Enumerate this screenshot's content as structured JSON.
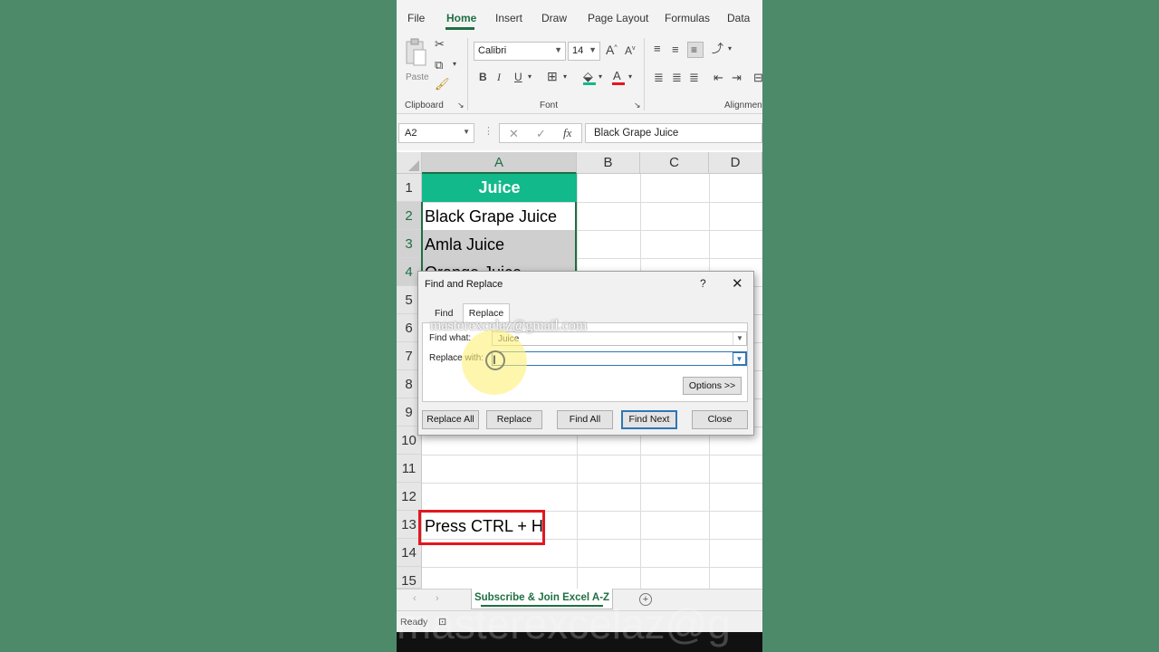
{
  "ribbon": {
    "tabs": [
      "File",
      "Home",
      "Insert",
      "Draw",
      "Page Layout",
      "Formulas",
      "Data"
    ],
    "active_tab": "Home",
    "clipboard": {
      "paste_label": "Paste",
      "group_label": "Clipboard"
    },
    "font": {
      "name": "Calibri",
      "size": "14",
      "group_label": "Font",
      "bold": "B",
      "italic": "I",
      "underline": "U",
      "font_color_glyph": "A",
      "grow_glyph": "A",
      "shrink_glyph": "A"
    },
    "alignment": {
      "group_label": "Alignment"
    }
  },
  "formula_bar": {
    "name_box": "A2",
    "fx_glyph": "fx",
    "value": "Black Grape Juice"
  },
  "grid": {
    "columns": [
      "A",
      "B",
      "C",
      "D"
    ],
    "rows": [
      "1",
      "2",
      "3",
      "4",
      "5",
      "6",
      "7",
      "8",
      "9",
      "10",
      "11",
      "12",
      "13",
      "14",
      "15"
    ],
    "cells": {
      "A1": "Juice",
      "A2": "Black Grape Juice",
      "A3": "Amla Juice",
      "A4": "Orange Juice",
      "A13": "Press CTRL + H"
    }
  },
  "dialog": {
    "title": "Find and Replace",
    "help": "?",
    "close": "✕",
    "tabs": [
      "Find",
      "Replace"
    ],
    "active_tab": "Replace",
    "find_what_label": "Find what:",
    "find_what_value": "Juice",
    "replace_with_label": "Replace with:",
    "replace_with_value": "",
    "options_button": "Options >>",
    "buttons": {
      "replace_all": "Replace All",
      "replace": "Replace",
      "find_all": "Find All",
      "find_next": "Find Next",
      "close": "Close"
    },
    "email_overlay": "masterexcelaz@gmail.com"
  },
  "sheets": {
    "active": "Subscribe & Join Excel A-Z"
  },
  "status": {
    "ready": "Ready"
  },
  "watermark": "masterexcelaz@g",
  "colors": {
    "accent": "#1f6e43",
    "header_fill": "#12b98a",
    "highlight_border": "#e2171f",
    "background": "#4d8a6a"
  }
}
